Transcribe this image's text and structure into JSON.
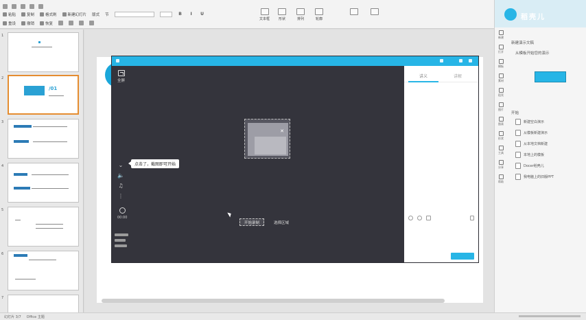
{
  "ribbon": {
    "row1": [
      "粘贴",
      "复制",
      "格式刷",
      "新建幻灯片",
      "版式",
      "节",
      "文本框",
      "形状",
      "排列",
      "轮廓",
      "查找",
      "替换",
      "选择"
    ],
    "row2": [
      "重设",
      "撤销",
      "恢复"
    ],
    "big_buttons": [
      "文本框",
      "形状",
      "排列",
      "轮廓"
    ]
  },
  "thumbnails": [
    "1",
    "2",
    "3",
    "4",
    "5",
    "6",
    "7"
  ],
  "overlay": {
    "fullscreen_label": "全屏",
    "tooltip": "点击了，截图即可开始",
    "timer_label": "00:00",
    "start_label": "开始录制",
    "hint_label": "选择区域"
  },
  "right_tabs": [
    "讲义",
    "讲解"
  ],
  "task_panel": {
    "brand": "稻壳儿",
    "title": "新建演示文稿",
    "subtitle": "从模板开始您的演示",
    "section": "开始",
    "list": [
      "新建空白演示",
      "从模板新建演示",
      "从本地文档新建",
      "本地上的模板",
      "Docer稻壳儿",
      "我电脑上的旧版PPT"
    ],
    "rail": [
      "新建",
      "打开",
      "模板",
      "素材",
      "稻壳",
      "图片",
      "图表",
      "形状",
      "工具",
      "分享",
      "帮助"
    ]
  },
  "status": {
    "slide": "幻灯片 3/7",
    "theme": "Office 主题"
  }
}
